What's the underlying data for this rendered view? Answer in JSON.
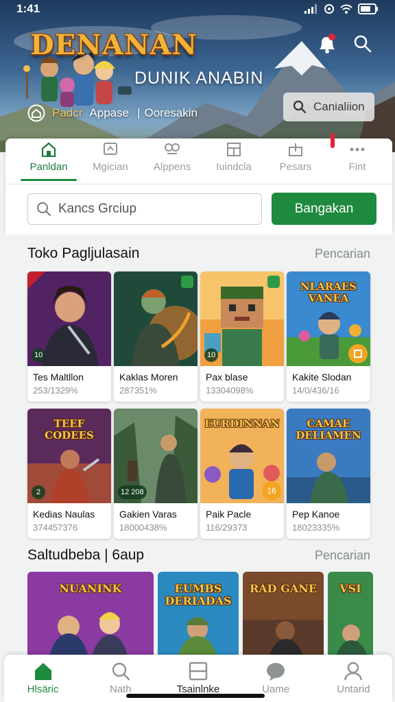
{
  "status_bar": {
    "time": "1:41"
  },
  "hero": {
    "brand": "DENANAN",
    "title": "DUNIK ANABIN",
    "meta_1": "Padcr",
    "meta_2": "Appase",
    "meta_sep": "|",
    "meta_3": "Ooresakin",
    "search_button": "Canialiion"
  },
  "tabs": [
    {
      "label": "Panldan",
      "icon": "home-icon",
      "active": true
    },
    {
      "label": "Mgician",
      "icon": "chat-icon"
    },
    {
      "label": "Alppens",
      "icon": "link-icon"
    },
    {
      "label": "Iuindcla",
      "icon": "grid-icon"
    },
    {
      "label": "Pesars",
      "icon": "box-icon"
    },
    {
      "label": "Fint",
      "icon": "more-icon"
    }
  ],
  "search": {
    "placeholder": "Kancs Grciup",
    "button": "Bangakan"
  },
  "section1": {
    "title": "Toko Pagljulasain",
    "link": "Pencarian",
    "cards": [
      {
        "name": "Tes Maltllon",
        "stat": "253/1329%",
        "badge": "10"
      },
      {
        "name": "Kaklas Moren",
        "stat": "287351%"
      },
      {
        "name": "Pax blase",
        "stat": "13304098%",
        "badge": "10"
      },
      {
        "name": "Kakite Slodan",
        "stat": "14/0/436/16",
        "label": "NLARAES VANEA"
      },
      {
        "name": "Kedias Naulas",
        "stat": "374457376",
        "badge": "2",
        "label": "TEEF CODEES"
      },
      {
        "name": "Gakien Varas",
        "stat": "18000438%",
        "badge": "12 208"
      },
      {
        "name": "Paik Pacle",
        "stat": "116/29373",
        "badge": "16",
        "label": "EURDINNAN"
      },
      {
        "name": "Pep Kanoe",
        "stat": "18023335%",
        "label": "CAMAE DELIAMEN"
      }
    ]
  },
  "section2": {
    "title": "Saltudbeba | 6aup",
    "link": "Pencarian",
    "strip": [
      {
        "label": "NUANINK"
      },
      {
        "label": "EUMBS DERIADAS"
      },
      {
        "label": "RAD GANE"
      },
      {
        "label": "VSI"
      }
    ]
  },
  "bottom_nav": [
    {
      "label": "Hlsäric",
      "icon": "home-icon",
      "active": true
    },
    {
      "label": "Nath",
      "icon": "search-icon"
    },
    {
      "label": "Tsainlnke",
      "icon": "window-icon"
    },
    {
      "label": "Uame",
      "icon": "chat-bubble-icon"
    },
    {
      "label": "Untarid",
      "icon": "profile-icon"
    }
  ],
  "colors": {
    "accent": "#1d8a3e",
    "badge_red": "#e02436",
    "badge_orange": "#f3a521"
  }
}
